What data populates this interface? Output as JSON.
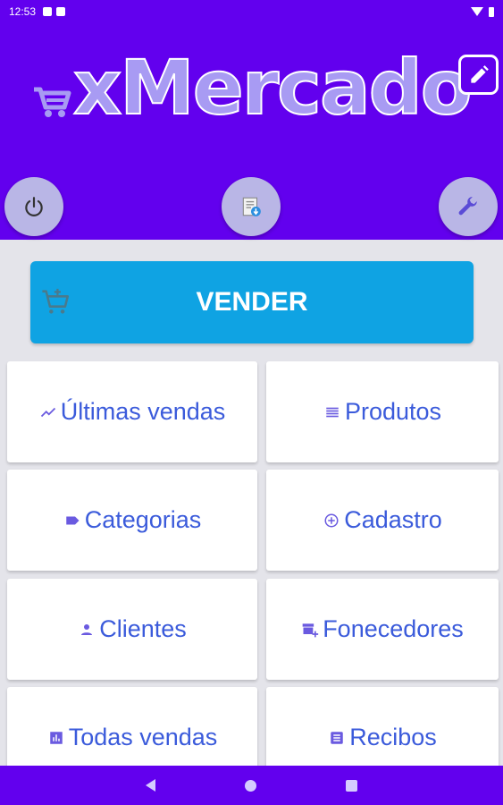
{
  "status_bar": {
    "time": "12:53"
  },
  "header": {
    "logo_text": "xMercado"
  },
  "vender": {
    "label": "VENDER"
  },
  "menu": {
    "ultimas_vendas": "Últimas vendas",
    "produtos": "Produtos",
    "categorias": "Categorias",
    "cadastro": "Cadastro",
    "clientes": "Clientes",
    "fornecedores": "Fonecedores",
    "todas_vendas": "Todas vendas",
    "recibos": "Recibos"
  },
  "icons": {
    "power": "power-icon",
    "document": "document-download-icon",
    "tool": "wrench-icon",
    "edit": "pencil-icon",
    "cart": "shopping-cart-icon"
  },
  "colors": {
    "primary": "#6200ee",
    "vender_bg": "#0fa3e3",
    "menu_text": "#3b5bdb",
    "icon_purple": "#6a5ae0",
    "round_btn": "#b9b6e6"
  }
}
